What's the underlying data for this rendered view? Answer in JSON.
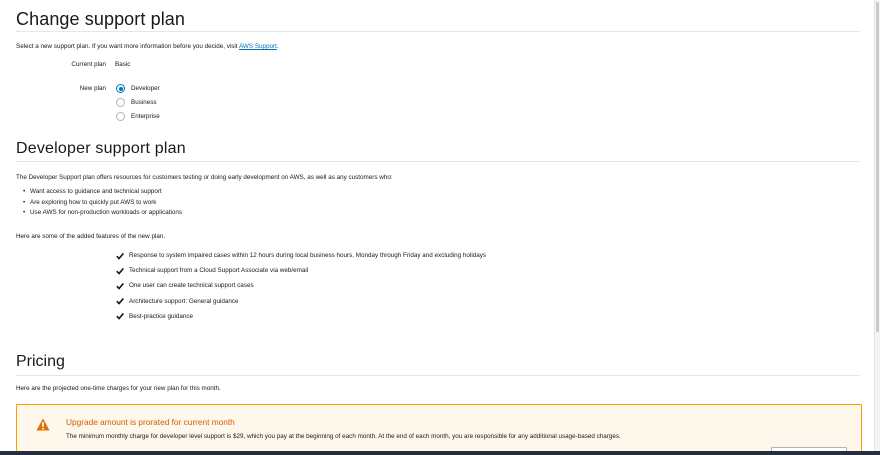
{
  "change_section": {
    "title": "Change support plan",
    "intro_text": "Select a new support plan. If you want more information before you decide, visit ",
    "intro_link": "AWS Support",
    "intro_end": ".",
    "current_plan_label": "Current plan",
    "current_plan_value": "Basic",
    "new_plan_label": "New plan",
    "plan_options": [
      {
        "label": "Developer",
        "checked": true
      },
      {
        "label": "Business",
        "checked": false
      },
      {
        "label": "Enterprise",
        "checked": false
      }
    ]
  },
  "developer_section": {
    "title": "Developer support plan",
    "description": "The Developer Support plan offers resources for customers testing or doing early development on AWS, as well as any customers who:",
    "bullets": [
      "Want access to guidance and technical support",
      "Are exploring how to quickly put AWS to work",
      "Use AWS for non-production workloads or applications"
    ],
    "added_features_text": "Here are some of the added features of the new plan.",
    "features": [
      "Response to system impaired cases within 12 hours during local business hours, Monday through Friday and excluding holidays",
      "Technical support from a Cloud Support Associate via web/email",
      "One user can create technical support cases",
      "Architecture support: General guidance",
      "Best-practice guidance"
    ]
  },
  "pricing_section": {
    "title": "Pricing",
    "intro_text": "Here are the projected one-time charges for your new plan for this month.",
    "alert": {
      "title": "Upgrade amount is prorated for current month",
      "text": "The minimum monthly charge for developer level support is $29, which you pay at the beginning of each month. At the end of each month, you are responsible for any additional usage-based charges."
    }
  },
  "colors": {
    "link": "#0073bb",
    "radio_checked": "#0073bb",
    "alert_border": "#ff9900",
    "alert_title": "#d45b07",
    "alert_background": "#fef8ec"
  },
  "icons": {
    "feature_check": "checkmark-icon",
    "alert": "warning-icon"
  }
}
